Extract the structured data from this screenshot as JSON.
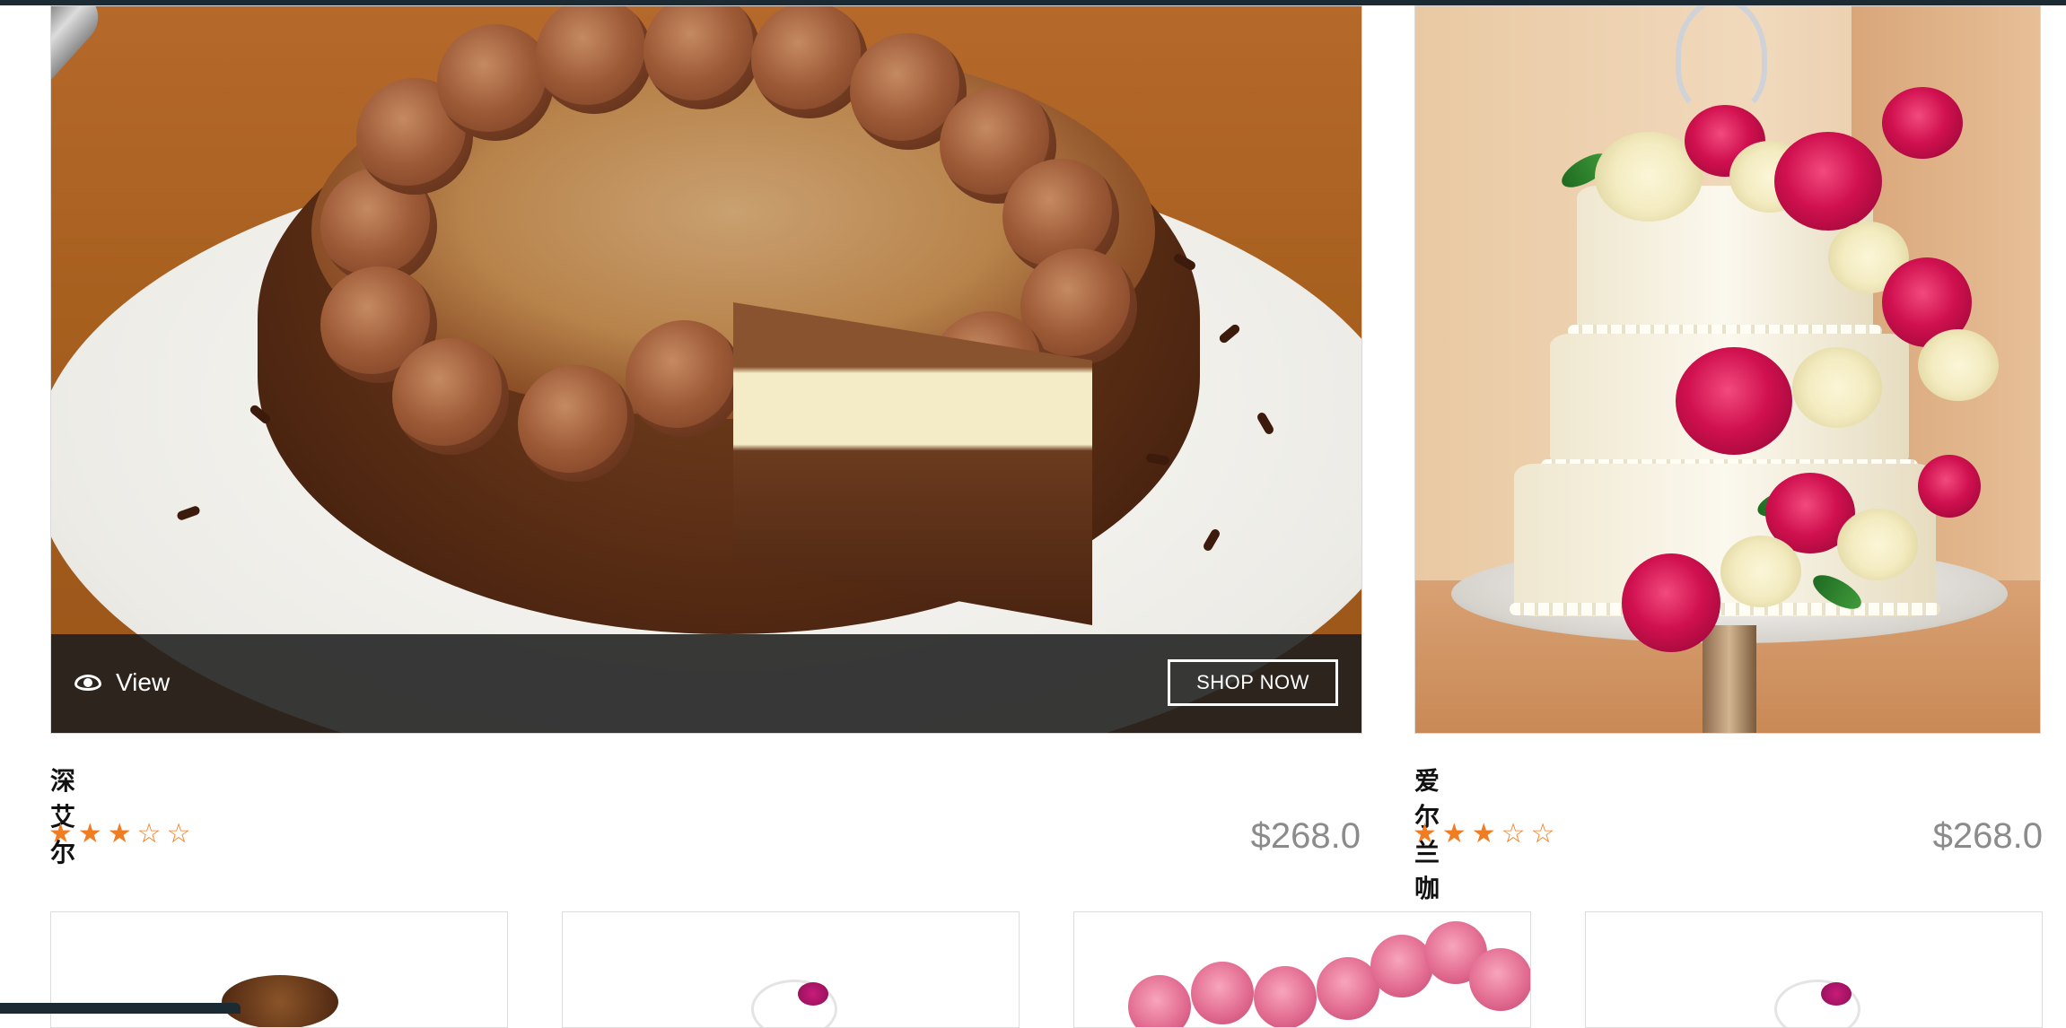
{
  "products_featured": [
    {
      "name": "深艾尔",
      "rating": 3,
      "rating_max": 5,
      "stars_text": "★★★☆☆",
      "price": "$268.0",
      "overlay": {
        "view_label": "View",
        "shop_label": "SHOP NOW"
      }
    },
    {
      "name": "爱尔兰咖啡",
      "rating": 3,
      "rating_max": 5,
      "stars_text": "★★★☆☆",
      "price": "$268.0"
    }
  ],
  "colors": {
    "star": "#f07d22",
    "price": "#8b8b8b",
    "overlay_bar": "#1e1e1e"
  },
  "icons": {
    "view": "eye-icon"
  }
}
